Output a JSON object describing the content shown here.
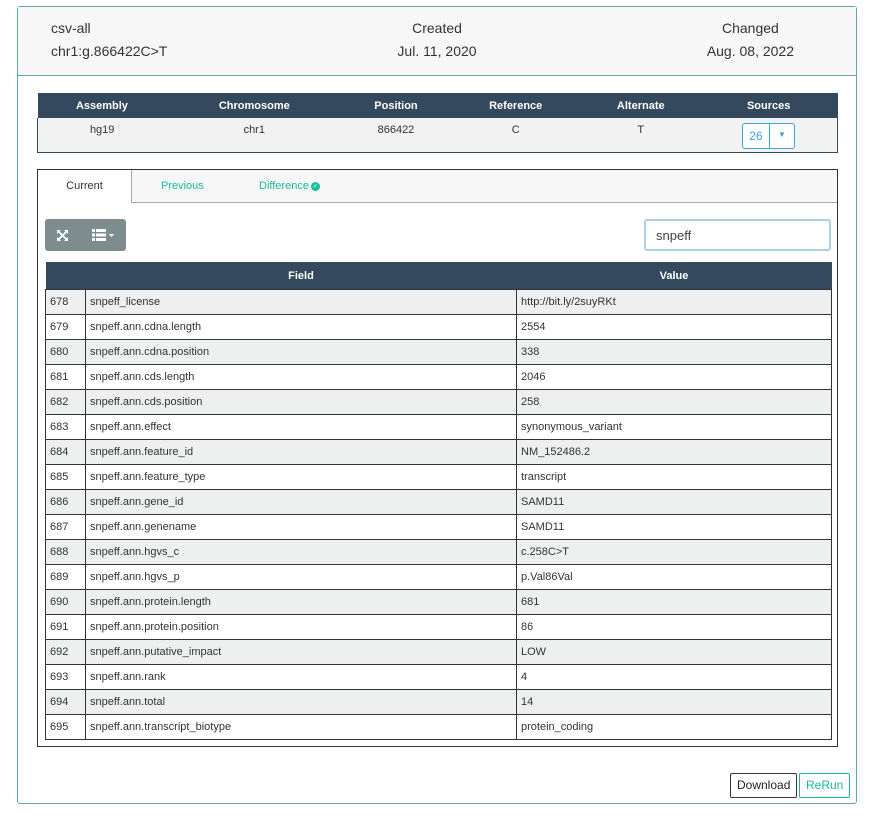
{
  "header": {
    "name": "csv-all",
    "variant_id": "chr1:g.866422C>T",
    "created_label": "Created",
    "created_date": "Jul. 11, 2020",
    "changed_label": "Changed",
    "changed_date": "Aug. 08, 2022"
  },
  "variant": {
    "columns": [
      "Assembly",
      "Chromosome",
      "Position",
      "Reference",
      "Alternate",
      "Sources"
    ],
    "values": [
      "hg19",
      "chr1",
      "866422",
      "C",
      "T"
    ],
    "sources_count": "26"
  },
  "tabs": {
    "current": "Current",
    "previous": "Previous",
    "difference": "Difference"
  },
  "search": {
    "value": "snpeff"
  },
  "table": {
    "headers": {
      "field": "Field",
      "value": "Value"
    },
    "rows": [
      {
        "num": "678",
        "field": "snpeff_license",
        "value": "http://bit.ly/2suyRKt"
      },
      {
        "num": "679",
        "field": "snpeff.ann.cdna.length",
        "value": "2554"
      },
      {
        "num": "680",
        "field": "snpeff.ann.cdna.position",
        "value": "338"
      },
      {
        "num": "681",
        "field": "snpeff.ann.cds.length",
        "value": "2046"
      },
      {
        "num": "682",
        "field": "snpeff.ann.cds.position",
        "value": "258"
      },
      {
        "num": "683",
        "field": "snpeff.ann.effect",
        "value": "synonymous_variant"
      },
      {
        "num": "684",
        "field": "snpeff.ann.feature_id",
        "value": "NM_152486.2"
      },
      {
        "num": "685",
        "field": "snpeff.ann.feature_type",
        "value": "transcript"
      },
      {
        "num": "686",
        "field": "snpeff.ann.gene_id",
        "value": "SAMD11"
      },
      {
        "num": "687",
        "field": "snpeff.ann.genename",
        "value": "SAMD11"
      },
      {
        "num": "688",
        "field": "snpeff.ann.hgvs_c",
        "value": "c.258C>T"
      },
      {
        "num": "689",
        "field": "snpeff.ann.hgvs_p",
        "value": "p.Val86Val"
      },
      {
        "num": "690",
        "field": "snpeff.ann.protein.length",
        "value": "681"
      },
      {
        "num": "691",
        "field": "snpeff.ann.protein.position",
        "value": "86"
      },
      {
        "num": "692",
        "field": "snpeff.ann.putative_impact",
        "value": "LOW"
      },
      {
        "num": "693",
        "field": "snpeff.ann.rank",
        "value": "4"
      },
      {
        "num": "694",
        "field": "snpeff.ann.total",
        "value": "14"
      },
      {
        "num": "695",
        "field": "snpeff.ann.transcript_biotype",
        "value": "protein_coding"
      }
    ]
  },
  "actions": {
    "download": "Download",
    "rerun": "ReRun"
  },
  "icons": {
    "expand": "expand-icon",
    "columns": "columns-list-icon",
    "check": "check-circle-icon"
  },
  "colors": {
    "accent": "#1abc9c",
    "header_dark": "#34495e",
    "info": "#3aa3d8"
  }
}
